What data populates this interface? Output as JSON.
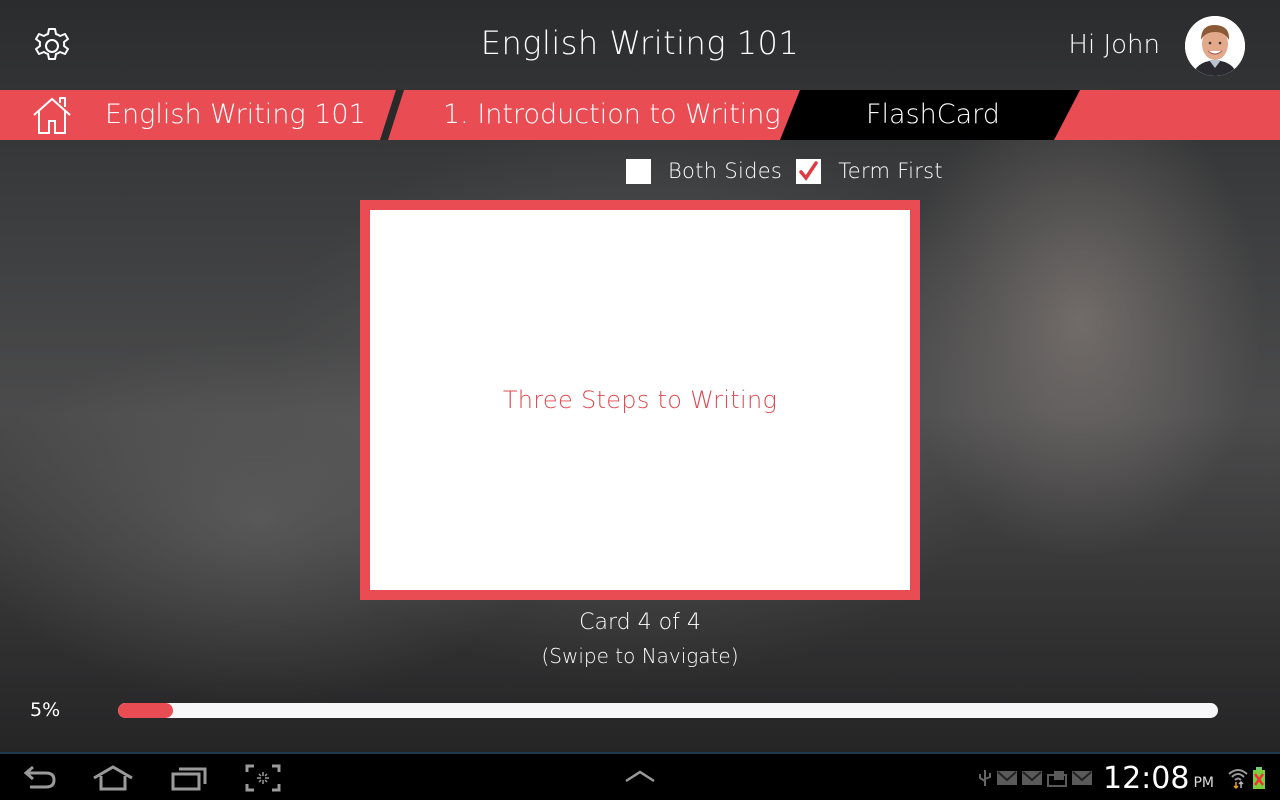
{
  "header": {
    "title": "English Writing 101",
    "greeting": "Hi John",
    "settings_icon": "gear-icon",
    "avatar_alt": "John profile photo"
  },
  "breadcrumbs": [
    {
      "label": "English Writing 101",
      "icon": "home-icon"
    },
    {
      "label": "1. Introduction to Writing"
    },
    {
      "label": "FlashCard",
      "active": true
    }
  ],
  "options": {
    "both_sides": {
      "label": "Both Sides",
      "checked": false
    },
    "term_first": {
      "label": "Term First",
      "checked": true
    }
  },
  "flashcard": {
    "text": "Three Steps to Writing",
    "counter": "Card 4 of 4",
    "hint": "(Swipe to Navigate)"
  },
  "progress": {
    "label": "5%",
    "value": 0.05
  },
  "system_bar": {
    "time": "12:08",
    "ampm": "PM",
    "nav_icons": [
      "back-icon",
      "home-icon",
      "recent-apps-icon",
      "screenshot-icon"
    ],
    "center_icon": "chevron-up-icon",
    "status_icons": [
      "usb-icon",
      "gmail-icon",
      "gmail-icon",
      "media-icon",
      "gmail-icon",
      "wifi-icon",
      "battery-icon"
    ]
  },
  "colors": {
    "accent": "#e94c53",
    "active_crumb": "#000000",
    "card_text": "#e04a52"
  }
}
